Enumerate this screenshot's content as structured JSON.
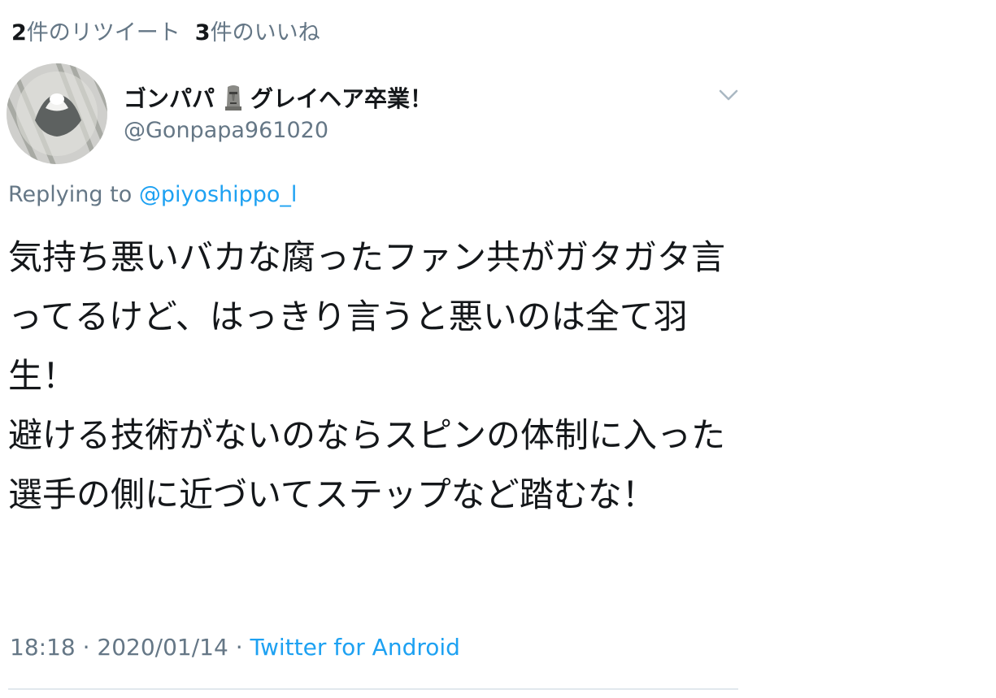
{
  "stats": {
    "retweet_count": "2",
    "retweet_label": "件のリツイート",
    "like_count": "3",
    "like_label": "件のいいね"
  },
  "user": {
    "display_name": "ゴンパパ",
    "display_name_suffix": "グレイヘア卒業！",
    "name_icon": "moai-icon",
    "handle": "@Gonpapa961020",
    "avatar_icon": "avatar"
  },
  "reply": {
    "prefix": "Replying to",
    "mention": "@piyoshippo_l"
  },
  "tweet": {
    "text": "気持ち悪いバカな腐ったファン共がガタガタ言ってるけど、はっきり言うと悪いのは全て羽生！\n避ける技術がないのならスピンの体制に入った選手の側に近づいてステップなど踏むな！"
  },
  "meta": {
    "time": "18:18",
    "separator": "·",
    "date": "2020/01/14",
    "source": "Twitter for Android"
  },
  "colors": {
    "text": "#14171a",
    "muted": "#657786",
    "link": "#1da1f2",
    "divider": "#e1e8ed"
  }
}
